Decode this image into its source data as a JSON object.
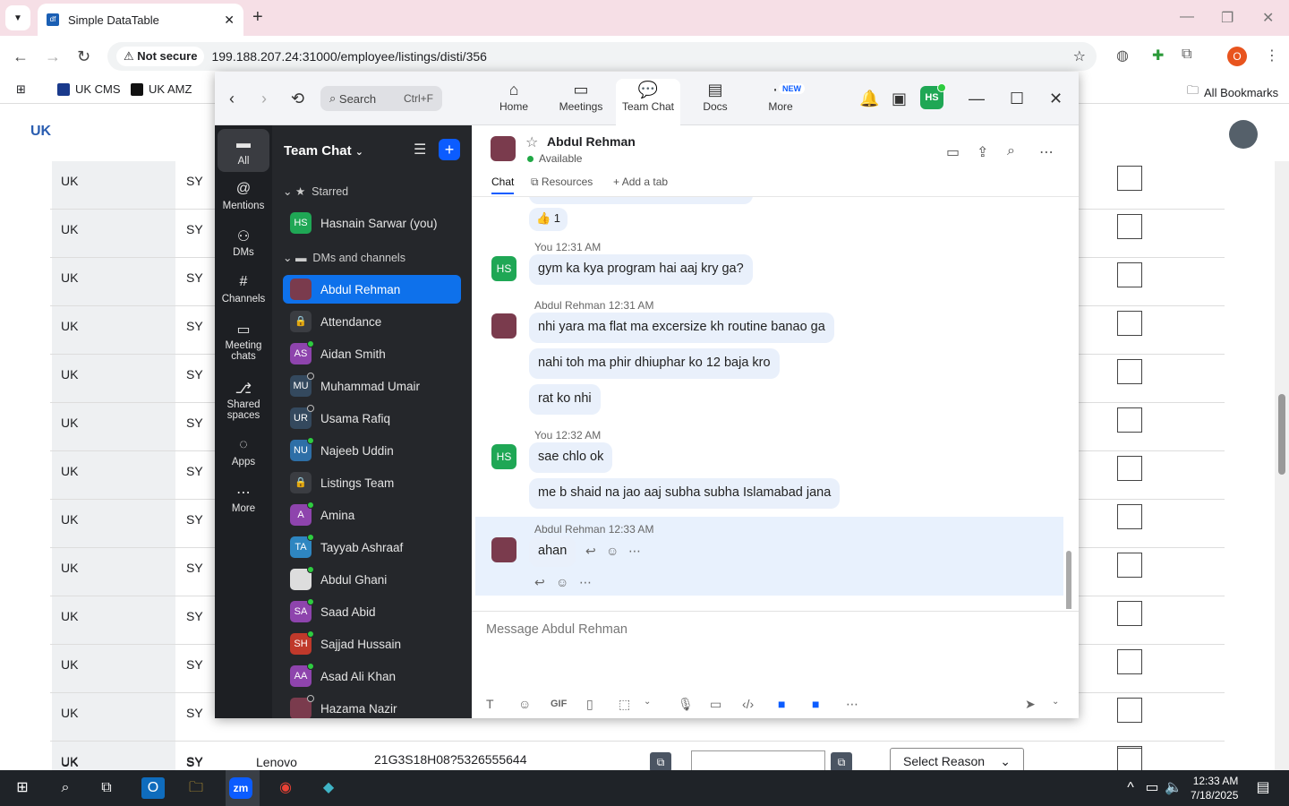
{
  "browser": {
    "tab_title": "Simple DataTable",
    "new_tab": "+",
    "not_secure": "Not secure",
    "url": "199.188.207.24:31000/employee/listings/disti/356",
    "profile_initial": "O",
    "bookmarks": [
      "UK CMS",
      "UK AMZ"
    ],
    "all_bookmarks": "All Bookmarks"
  },
  "page": {
    "rows": [
      {
        "c1": "UK",
        "c2": "SY"
      },
      {
        "c1": "UK",
        "c2": "SY"
      },
      {
        "c1": "UK",
        "c2": "SY"
      },
      {
        "c1": "UK",
        "c2": "SY"
      },
      {
        "c1": "UK",
        "c2": "SY"
      },
      {
        "c1": "UK",
        "c2": "SY"
      },
      {
        "c1": "UK",
        "c2": "SY"
      },
      {
        "c1": "UK",
        "c2": "SY"
      },
      {
        "c1": "UK",
        "c2": "SY"
      },
      {
        "c1": "UK",
        "c2": "SY"
      },
      {
        "c1": "UK",
        "c2": "SY"
      },
      {
        "c1": "UK",
        "c2": "SY"
      },
      {
        "c1": "UK",
        "c2": "SY"
      }
    ],
    "last_row": {
      "c1": "UK",
      "c2": "SY",
      "brand": "Lenovo",
      "serial": "21G3S18H08?5326555644",
      "select": "Select Reason"
    }
  },
  "zoom": {
    "search_placeholder": "Search",
    "search_shortcut": "Ctrl+F",
    "nav": [
      "Home",
      "Meetings",
      "Team Chat",
      "Docs",
      "More"
    ],
    "new_badge": "NEW",
    "user_initials": "HS",
    "rail": [
      "All",
      "Mentions",
      "DMs",
      "Channels",
      "Meeting chats",
      "Shared spaces",
      "Apps",
      "More"
    ],
    "sidebar_title": "Team Chat",
    "starred_label": "Starred",
    "dms_label": "DMs and channels",
    "starred": [
      {
        "initials": "HS",
        "name": "Hasnain Sarwar (you)",
        "color": "#1fa755"
      }
    ],
    "contacts": [
      {
        "initials": "",
        "name": "Abdul Rehman",
        "color": "#7a3b4d",
        "active": true
      },
      {
        "initials": "🔒",
        "name": "Attendance",
        "color": "#3b3d42"
      },
      {
        "initials": "AS",
        "name": "Aidan Smith",
        "color": "#8e44ad",
        "status": "on"
      },
      {
        "initials": "MU",
        "name": "Muhammad Umair",
        "color": "#34495e",
        "status": "off"
      },
      {
        "initials": "UR",
        "name": "Usama Rafiq",
        "color": "#34495e",
        "status": "off"
      },
      {
        "initials": "NU",
        "name": "Najeeb Uddin",
        "color": "#2e6fa7",
        "status": "on"
      },
      {
        "initials": "🔒",
        "name": "Listings Team",
        "color": "#3b3d42"
      },
      {
        "initials": "A",
        "name": "Amina",
        "color": "#8e44ad",
        "status": "on"
      },
      {
        "initials": "TA",
        "name": "Tayyab Ashraaf",
        "color": "#2e86c1",
        "status": "on"
      },
      {
        "initials": "",
        "name": "Abdul Ghani",
        "color": "#dddddd",
        "status": "on"
      },
      {
        "initials": "SA",
        "name": "Saad Abid",
        "color": "#8e44ad",
        "status": "on"
      },
      {
        "initials": "SH",
        "name": "Sajjad Hussain",
        "color": "#c0392b",
        "status": "on"
      },
      {
        "initials": "AA",
        "name": "Asad Ali Khan",
        "color": "#8e44ad",
        "status": "on"
      },
      {
        "initials": "",
        "name": "Hazama Nazir",
        "color": "#7a3b4d",
        "status": "off"
      }
    ],
    "chat": {
      "name": "Abdul Rehman",
      "status": "Available",
      "tabs": [
        "Chat",
        "Resources",
        "Add a tab"
      ],
      "reaction": "👍 1",
      "messages": [
        {
          "meta_name": "You",
          "time": "12:31 AM",
          "who": "HS",
          "text": "gym ka kya program hai aaj kry ga?"
        },
        {
          "meta_name": "Abdul Rehman",
          "time": "12:31 AM",
          "who": "AR",
          "text": "nhi yara ma  flat ma excersize kh routine banao ga"
        },
        {
          "text": "nahi toh ma phir dhiuphar ko 12 baja kro"
        },
        {
          "text": "rat ko nhi"
        },
        {
          "meta_name": "You",
          "time": "12:32 AM",
          "who": "HS",
          "text": "sae chlo ok"
        },
        {
          "text": "me b shaid na jao aaj subha subha Islamabad jana"
        },
        {
          "meta_name": "Abdul Rehman",
          "time": "12:33 AM",
          "who": "AR",
          "text": "ahan"
        }
      ],
      "composer_placeholder": "Message Abdul Rehman",
      "gif": "GIF"
    }
  },
  "taskbar": {
    "time": "12:33 AM",
    "date": "7/18/2025",
    "zoom_label": "zm"
  }
}
